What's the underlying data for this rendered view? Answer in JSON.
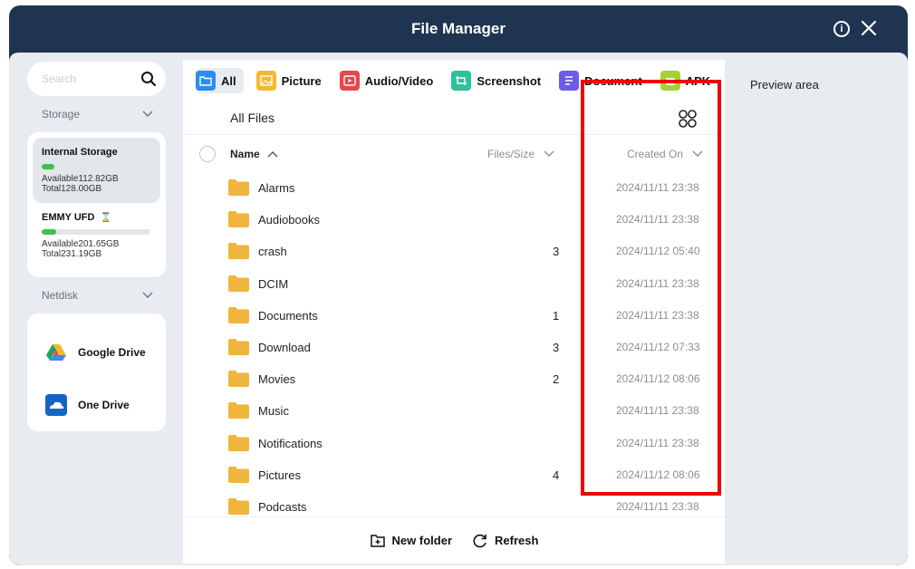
{
  "window": {
    "title": "File Manager"
  },
  "sidebar": {
    "search_placeholder": "Search",
    "storage_section_label": "Storage",
    "storage_items": [
      {
        "name": "Internal Storage",
        "available": "Available112.82GB",
        "total": "Total128.00GB",
        "used_fraction": 0.12
      },
      {
        "name": "EMMY UFD",
        "available": "Available201.65GB",
        "total": "Total231.19GB",
        "used_fraction": 0.13
      }
    ],
    "netdisk_section_label": "Netdisk",
    "netdisk_items": [
      {
        "label": "Google Drive",
        "icon": "google-drive-icon"
      },
      {
        "label": "One Drive",
        "icon": "one-drive-icon"
      }
    ]
  },
  "categories": [
    {
      "label": "All",
      "color": "#2d8cf0"
    },
    {
      "label": "Picture",
      "color": "#f5b82e"
    },
    {
      "label": "Audio/Video",
      "color": "#e5484d"
    },
    {
      "label": "Screenshot",
      "color": "#2fbf9a"
    },
    {
      "label": "Document",
      "color": "#6c5ce7"
    },
    {
      "label": "APK",
      "color": "#a3d13a"
    }
  ],
  "path_label": "All Files",
  "columns": {
    "name": "Name",
    "size": "Files/Size",
    "date": "Created On"
  },
  "files": [
    {
      "name": "Alarms",
      "count": "",
      "created": "2024/11/11 23:38"
    },
    {
      "name": "Audiobooks",
      "count": "",
      "created": "2024/11/11 23:38"
    },
    {
      "name": "crash",
      "count": "3",
      "created": "2024/11/12 05:40"
    },
    {
      "name": "DCIM",
      "count": "",
      "created": "2024/11/11 23:38"
    },
    {
      "name": "Documents",
      "count": "1",
      "created": "2024/11/11 23:38"
    },
    {
      "name": "Download",
      "count": "3",
      "created": "2024/11/12 07:33"
    },
    {
      "name": "Movies",
      "count": "2",
      "created": "2024/11/12 08:06"
    },
    {
      "name": "Music",
      "count": "",
      "created": "2024/11/11 23:38"
    },
    {
      "name": "Notifications",
      "count": "",
      "created": "2024/11/11 23:38"
    },
    {
      "name": "Pictures",
      "count": "4",
      "created": "2024/11/12 08:06"
    },
    {
      "name": "Podcasts",
      "count": "",
      "created": "2024/11/11 23:38"
    }
  ],
  "actions": {
    "new_folder": "New folder",
    "refresh": "Refresh"
  },
  "preview": {
    "label": "Preview area"
  },
  "colors": {
    "titlebar": "#1e3451",
    "folder": "#f0b53c",
    "storage_fill": "#3cc24a",
    "highlight": "#f00000"
  }
}
